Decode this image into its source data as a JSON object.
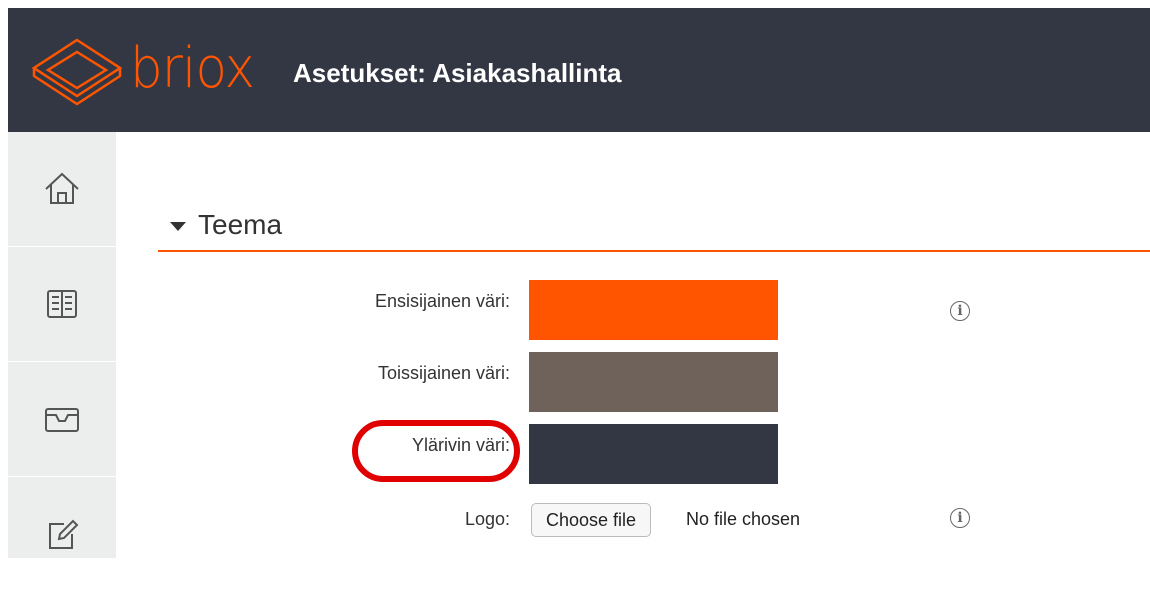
{
  "header": {
    "brand": "briox",
    "title": "Asetukset: Asiakashallinta",
    "background": "#333744",
    "accent": "#ff5500"
  },
  "sidebar": {
    "items": [
      {
        "icon": "home-icon"
      },
      {
        "icon": "book-icon"
      },
      {
        "icon": "inbox-icon"
      },
      {
        "icon": "edit-icon"
      }
    ]
  },
  "section": {
    "title": "Teema",
    "expanded": true
  },
  "fields": {
    "primary_color": {
      "label": "Ensisijainen väri:",
      "value": "#ff5500"
    },
    "secondary_color": {
      "label": "Toissijainen väri:",
      "value": "#6e625b"
    },
    "topbar_color": {
      "label": "Ylärivin väri:",
      "value": "#333744",
      "highlighted": true
    },
    "logo": {
      "label": "Logo:",
      "button_label": "Choose file",
      "status": "No file chosen"
    }
  },
  "info_icon_glyph": "i"
}
